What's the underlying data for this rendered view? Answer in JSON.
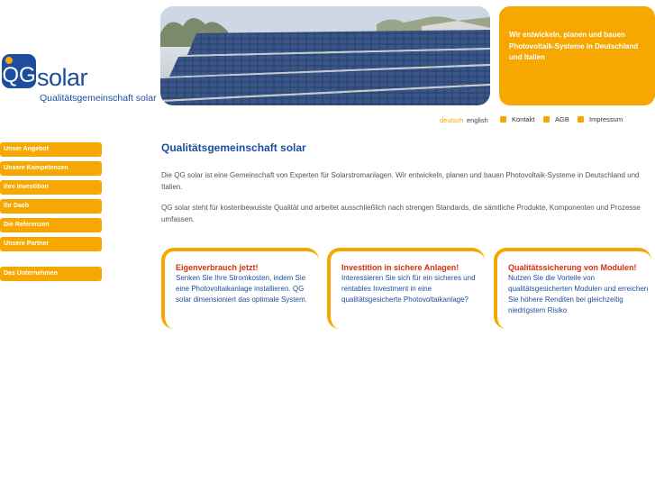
{
  "logo": {
    "word": "solar",
    "subtitle": "Qualitätsgemeinschaft solar"
  },
  "banner": {
    "text": "Wir entwickeln, planen und bauen Photovoltaik-Systeme in Deutschland und Italien"
  },
  "toplinks": {
    "lang_active": "deutsch",
    "lang_other": "english",
    "items": [
      "Kontakt",
      "AGB",
      "Impressum"
    ]
  },
  "nav": [
    "Unser Angebot",
    "Unsere Kompetenzen",
    "Ihre Investition",
    "Ihr Dach",
    "Die Referenzen",
    "Unsere Partner",
    "Das Unternehmen"
  ],
  "main": {
    "title": "Qualitätsgemeinschaft solar",
    "para1": "Die QG solar ist eine Gemeinschaft von Experten für Solarstromanlagen. Wir entwickeln, planen und bauen Photovoltaik-Systeme in Deutschland und Italien.",
    "para2": "QG solar steht für kostenbewusste Qualität und arbeitet ausschließlich nach strengen Standards, die sämtliche Produkte, Komponenten und Prozesse umfassen."
  },
  "features": [
    {
      "title": "Eigenverbrauch jetzt!",
      "text": "Senken Sie Ihre Stromkosten, indem Sie eine Photovoltaikanlage installieren. QG solar dimensioniert das optimale System."
    },
    {
      "title": "Investition in sichere Anlagen!",
      "text": "Interessieren Sie sich für ein sicheres und rentables Investment in eine qualitätsgesicherte Photovoltaikanlage?"
    },
    {
      "title": "Qualitätssicherung von Modulen!",
      "text": "Nutzen Sie die Vorteile von qualitätsgesicherten Modulen und erreichen Sie höhere Renditen bei gleichzeitig niedrigstem Risiko"
    }
  ],
  "colors": {
    "accent": "#f6a800",
    "brand_blue": "#1d4e9e",
    "feature_title_red": "#d03010"
  }
}
